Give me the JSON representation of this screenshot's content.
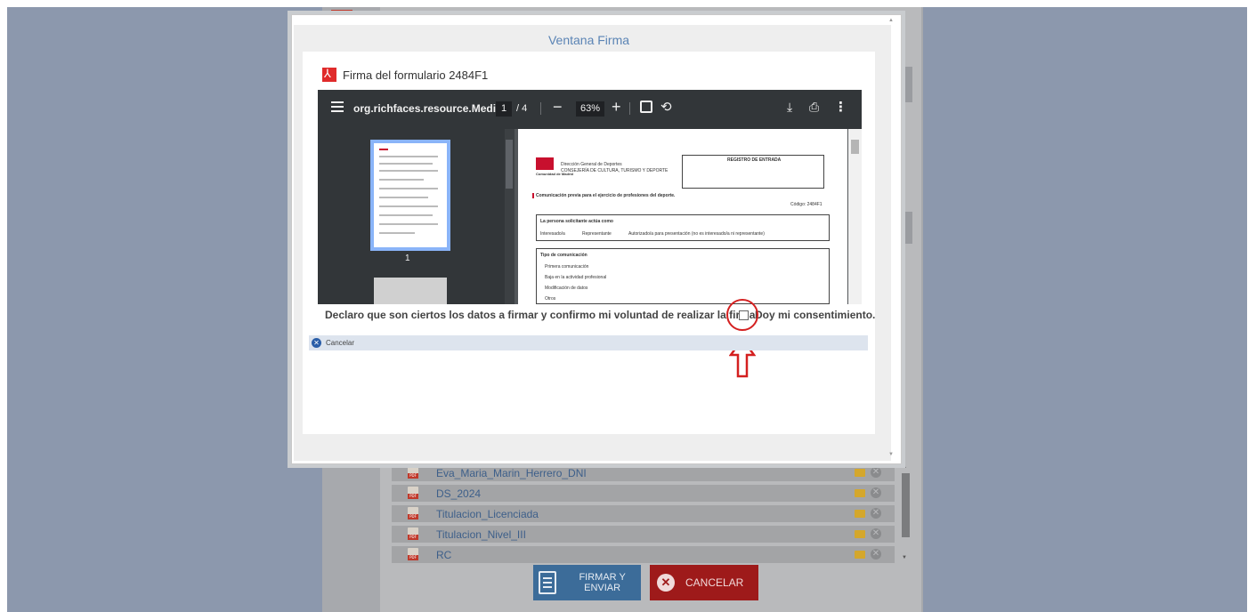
{
  "modal": {
    "title": "Ventana Firma",
    "form_title": "Firma del formulario 2484F1",
    "declaration": "Declaro que son ciertos los datos a firmar y confirmo mi voluntad de realizar la firma.",
    "consent_label": "Doy mi consentimiento.",
    "consent_checked": false,
    "cancel_label": "Cancelar"
  },
  "viewer": {
    "filename": "org.richfaces.resource.Medi...",
    "current_page": "1",
    "total_pages": "/ 4",
    "zoom": "63%",
    "thumbnail_page": "1",
    "document": {
      "registro": "REGISTRO DE ENTRADA",
      "org_line1": "Dirección General de Deportes",
      "org_line2": "CONSEJERÍA DE CULTURA, TURISMO Y DEPORTE",
      "logo_text": "Comunidad de Madrid",
      "form_heading": "Comunicación previa para el ejercicio de profesiones del deporte.",
      "code": "Código: 2484F1",
      "section1": "La persona solicitante actúa como",
      "section1_options": [
        "Interesado/a",
        "Representante",
        "Autorizado/a para presentación (no es interesado/a ni representante)"
      ],
      "section2": "Tipo de comunicación",
      "section2_options": [
        "Primera comunicación",
        "Baja en la actividad profesional",
        "Modificación de datos",
        "Otros"
      ]
    }
  },
  "attachments": [
    {
      "name": "Eva_Maria_Marin_Herrero_DNI"
    },
    {
      "name": "DS_2024"
    },
    {
      "name": "Titulacion_Licenciada"
    },
    {
      "name": "Titulacion_Nivel_III"
    },
    {
      "name": "RC"
    }
  ],
  "actions": {
    "firmar_label": "FIRMAR Y ENVIAR",
    "cancelar_label": "CANCELAR"
  },
  "colors": {
    "modal_title": "#5b84b5",
    "firmar_button": "#3c6c99",
    "cancelar_button": "#9e1a1a",
    "highlight": "#d42020"
  }
}
